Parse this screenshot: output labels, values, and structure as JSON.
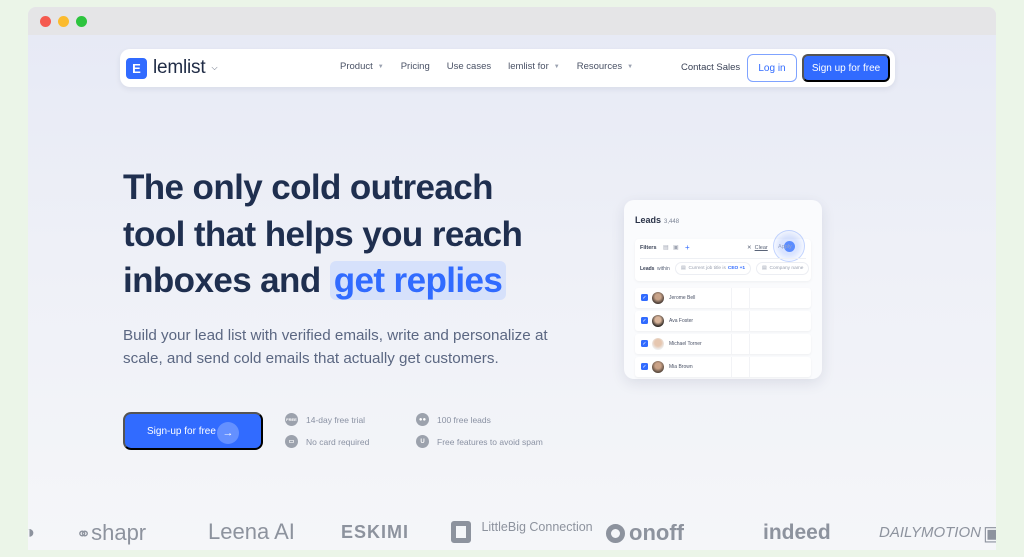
{
  "window": {
    "controls": [
      "close",
      "minimize",
      "maximize"
    ]
  },
  "navbar": {
    "logo_mark": "E",
    "logo_text": "lemlist",
    "logo_caret": "⌄",
    "links": [
      {
        "label": "Product",
        "has_dropdown": true
      },
      {
        "label": "Pricing",
        "has_dropdown": false
      },
      {
        "label": "Use cases",
        "has_dropdown": false
      },
      {
        "label": "lemlist for",
        "has_dropdown": true
      },
      {
        "label": "Resources",
        "has_dropdown": true
      }
    ],
    "caret": "▼",
    "contact_label": "Contact Sales",
    "login_label": "Log in",
    "signup_label": "Sign up for free"
  },
  "hero": {
    "title_lines": [
      "The only cold outreach",
      "tool that helps you reach",
      "inboxes and "
    ],
    "title_highlight": "get replies",
    "subtitle": "Build your lead list with verified emails, write and personalize at scale, and send cold emails that actually get customers.",
    "cta_label": "Sign-up for free",
    "cta_arrow": "→",
    "perks": [
      {
        "icon": "free-tag-icon",
        "glyph": "FREE",
        "label": "14-day free trial"
      },
      {
        "icon": "users-icon",
        "glyph": "👥",
        "label": "100 free leads"
      },
      {
        "icon": "card-icon",
        "glyph": "▭",
        "label": "No card required"
      },
      {
        "icon": "shield-icon",
        "glyph": "U",
        "label": "Free features to avoid spam"
      }
    ]
  },
  "leads_card": {
    "title": "Leads",
    "count": "3,448",
    "filters_label": "Filters",
    "add_icon": "+",
    "clear_label": "Clear",
    "apply_label": "Apply",
    "leads_label": "Leads",
    "within_label": "within",
    "chip_job_prefix": "Current job title is",
    "chip_job_value": "CEO +1",
    "chip_company": "Company name",
    "rows": [
      {
        "name": "Jerome Bell",
        "checked": true
      },
      {
        "name": "Ava Foster",
        "checked": true
      },
      {
        "name": "Michael Torner",
        "checked": true
      },
      {
        "name": "Mia Brown",
        "checked": true
      }
    ]
  },
  "logos": [
    "shapr",
    "Leena AI",
    "ESKIMI",
    "LittleBig Connection",
    "onoff",
    "indeed",
    "DAILYMOTION"
  ],
  "colors": {
    "brand_blue": "#316bff",
    "heading": "#1f2f4f",
    "highlight_bg": "#d6e1fb"
  }
}
